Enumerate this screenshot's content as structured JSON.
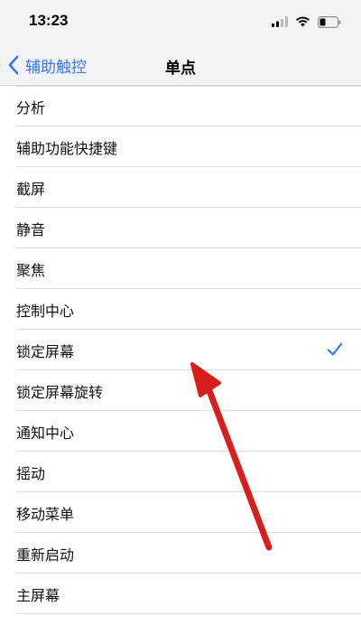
{
  "status": {
    "time": "13:23"
  },
  "nav": {
    "back_label": "辅助触控",
    "title": "单点"
  },
  "list": {
    "items": [
      {
        "label": "分析",
        "selected": false
      },
      {
        "label": "辅助功能快捷键",
        "selected": false
      },
      {
        "label": "截屏",
        "selected": false
      },
      {
        "label": "静音",
        "selected": false
      },
      {
        "label": "聚焦",
        "selected": false
      },
      {
        "label": "控制中心",
        "selected": false
      },
      {
        "label": "锁定屏幕",
        "selected": true
      },
      {
        "label": "锁定屏幕旋转",
        "selected": false
      },
      {
        "label": "通知中心",
        "selected": false
      },
      {
        "label": "摇动",
        "selected": false
      },
      {
        "label": "移动菜单",
        "selected": false
      },
      {
        "label": "重新启动",
        "selected": false
      },
      {
        "label": "主屏幕",
        "selected": false
      }
    ]
  },
  "colors": {
    "accent": "#3478f6",
    "annotation_arrow": "#d81d1d"
  }
}
